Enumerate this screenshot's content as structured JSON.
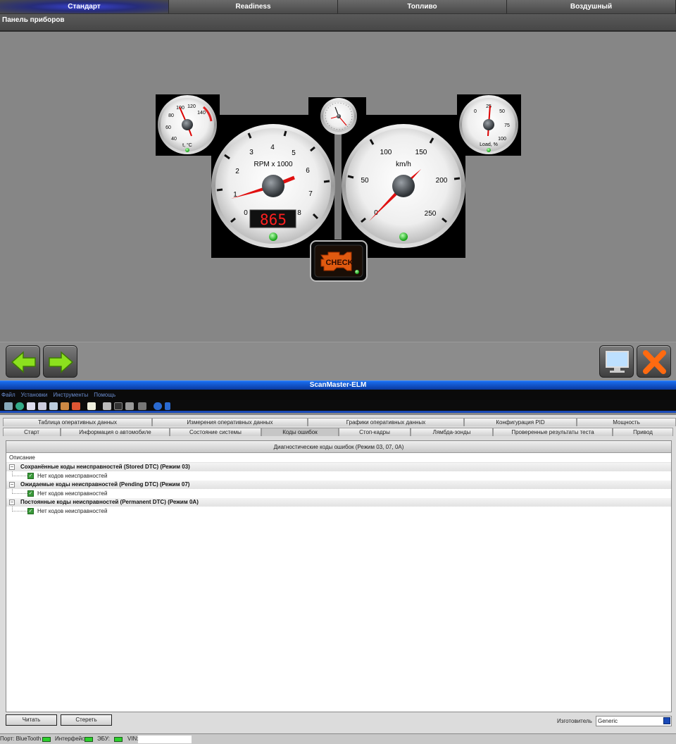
{
  "top_tabs": [
    {
      "label": "Стандарт",
      "active": true
    },
    {
      "label": "Readiness",
      "active": false
    },
    {
      "label": "Топливо",
      "active": false
    },
    {
      "label": "Воздушный",
      "active": false
    }
  ],
  "panel_title": "Панель приборов",
  "gauges": {
    "temperature": {
      "labels": [
        "40",
        "60",
        "80",
        "100",
        "120",
        "140"
      ],
      "title": "t, °C"
    },
    "rpm": {
      "labels": [
        "0",
        "1",
        "2",
        "3",
        "4",
        "5",
        "6",
        "7",
        "8"
      ],
      "title": "RPM x 1000",
      "display": "865"
    },
    "speed": {
      "labels": [
        "0",
        "50",
        "100",
        "150",
        "200",
        "250"
      ],
      "title": "km/h"
    },
    "load": {
      "labels": [
        "0",
        "25",
        "50",
        "75",
        "100"
      ],
      "title": "Load, %"
    },
    "check_engine": "CHECK"
  },
  "app": {
    "title": "ScanMaster-ELM",
    "menu": [
      "Файл",
      "Установки",
      "Инструменты",
      "Помощь"
    ]
  },
  "tabs_row1": [
    "Таблица оперативных данных",
    "Измерения оперативных данных",
    "Графики оперативных данных",
    "Конфигурация PID",
    "Мощность"
  ],
  "tabs_row2": [
    "Старт",
    "Информация о автомобиле",
    "Состояние системы",
    "Коды ошибок",
    "Стоп-кадры",
    "Лямбда-зонды",
    "Проверенные результаты теста",
    "Привод"
  ],
  "active_tab_row2": "Коды ошибок",
  "dtc": {
    "title": "Диагностические коды ошибок (Режим 03, 07, 0A)",
    "column": "Описание",
    "groups": [
      {
        "label": "Сохранённые коды неисправностей (Stored DTC) (Режим 03)",
        "item": "Нет кодов неисправностей"
      },
      {
        "label": "Ожидаемые коды неисправностей (Pending DTC) (Режим 07)",
        "item": "Нет кодов неисправностей"
      },
      {
        "label": "Постоянные коды неисправностей (Permanent DTC) (Режим 0A)",
        "item": "Нет кодов неисправностей"
      }
    ]
  },
  "buttons": {
    "read": "Читать",
    "erase": "Стереть"
  },
  "manufacturer": {
    "label": "Изготовитель",
    "value": "Generic"
  },
  "status": {
    "port": "Порт: BlueTooth",
    "interface": "Интерфейс:",
    "ecu": "ЭБУ:",
    "vin": "VIN:"
  }
}
